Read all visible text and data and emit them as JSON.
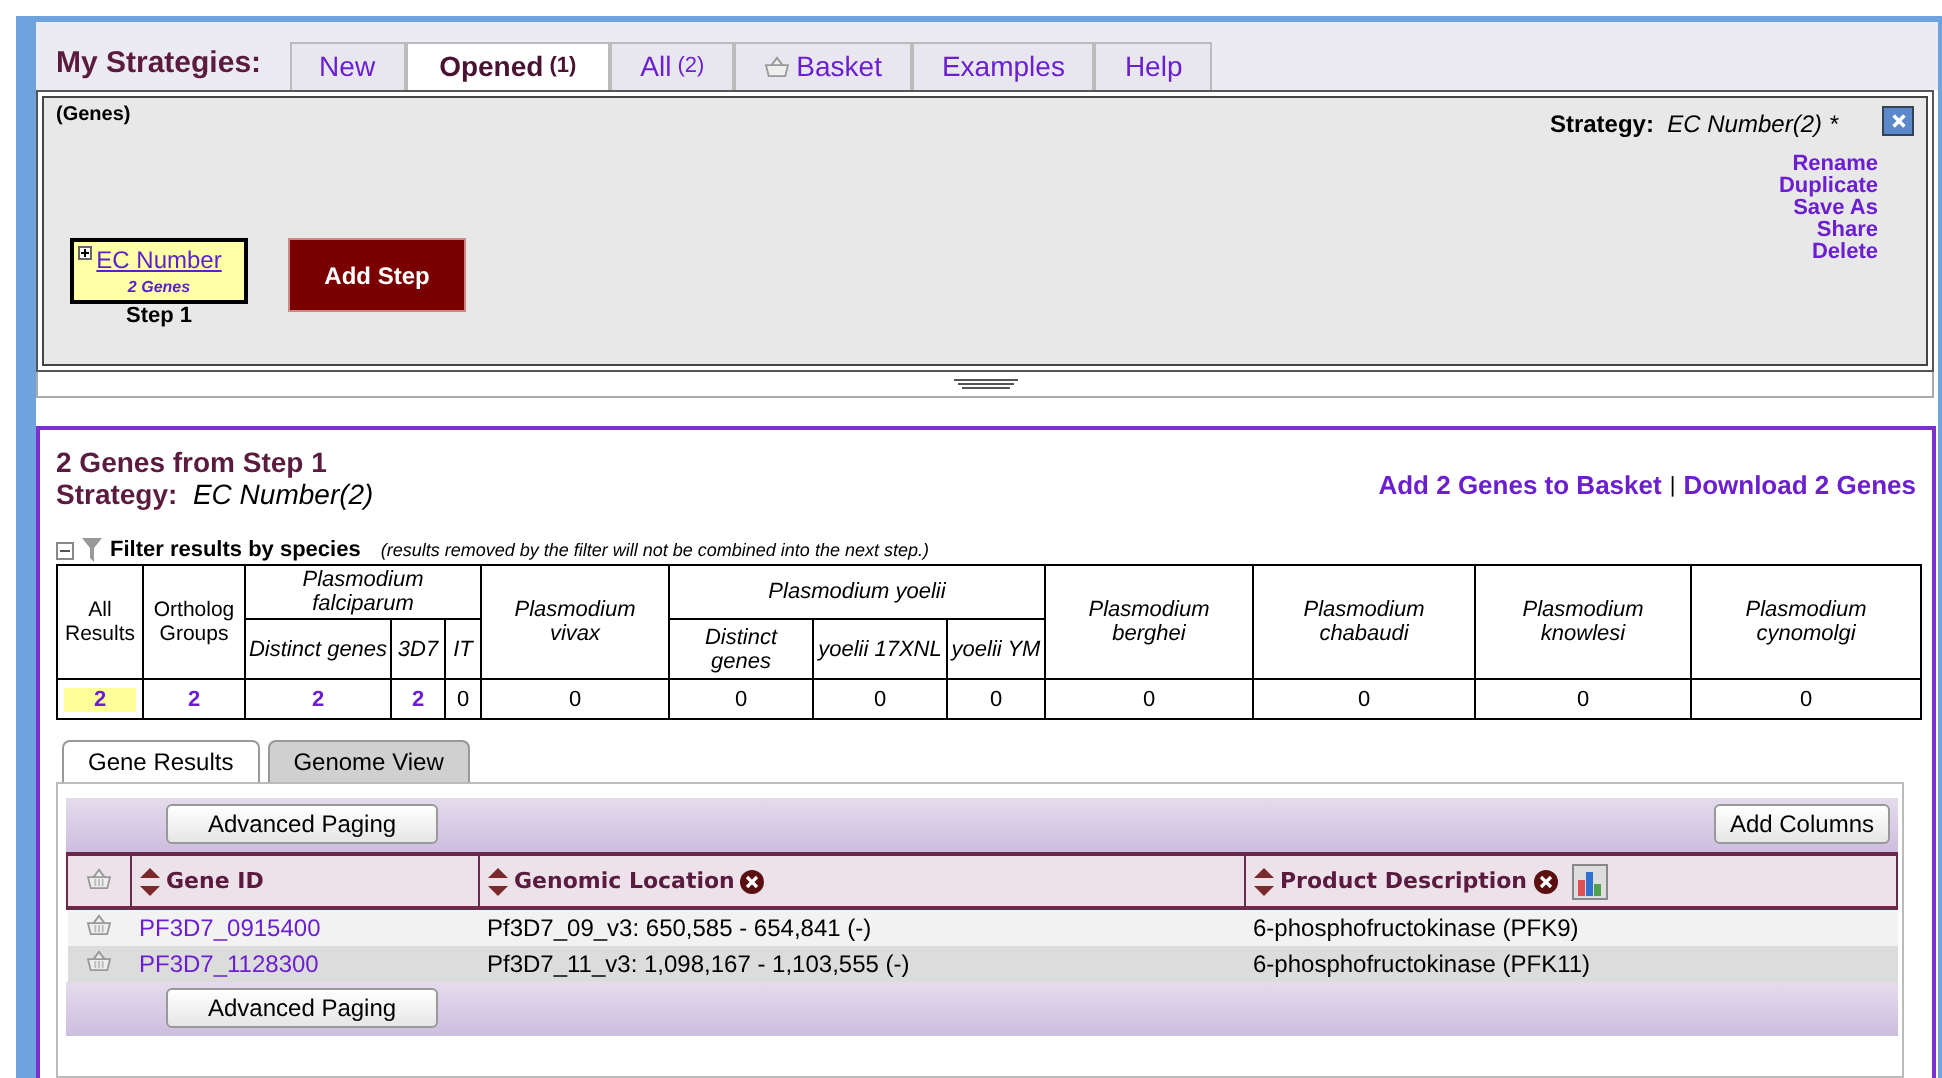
{
  "header": {
    "title": "My Strategies:"
  },
  "tabs": [
    {
      "label": "New",
      "kind": "text",
      "selected": false
    },
    {
      "label": "Opened",
      "count": "(1)",
      "kind": "text",
      "selected": true
    },
    {
      "label": "All",
      "count": "(2)",
      "kind": "text",
      "selected": false
    },
    {
      "label": "Basket",
      "kind": "basket",
      "selected": false
    },
    {
      "label": "Examples",
      "kind": "text",
      "selected": false
    },
    {
      "label": "Help",
      "kind": "text",
      "selected": false
    }
  ],
  "strategy_panel": {
    "type_label": "(Genes)",
    "strategy_label": "Strategy:",
    "strategy_name": "EC Number(2) *",
    "actions": [
      "Rename",
      "Duplicate",
      "Save As",
      "Share",
      "Delete"
    ],
    "step": {
      "name": "EC Number",
      "count": "2 Genes",
      "label": "Step 1"
    },
    "add_step": "Add Step"
  },
  "results": {
    "title": "2 Genes from Step 1",
    "strategy_label": "Strategy:",
    "strategy_name": "EC Number(2)",
    "links": [
      "Add 2 Genes to Basket",
      "Download 2 Genes"
    ],
    "link_separator": "|",
    "filter": {
      "title": "Filter results by species",
      "note": "(results removed by the filter will not be combined into the next step.)",
      "expanded": true,
      "columns": [
        {
          "label": "All Results",
          "kind": "summary"
        },
        {
          "label": "Ortholog Groups",
          "kind": "summary"
        },
        {
          "label": "Plasmodium falciparum",
          "kind": "species",
          "children": [
            "Distinct genes",
            "3D7",
            "IT"
          ]
        },
        {
          "label": "Plasmodium vivax",
          "kind": "species"
        },
        {
          "label": "Plasmodium yoelii",
          "kind": "species",
          "children": [
            "Distinct genes",
            "yoelii 17XNL",
            "yoelii YM"
          ]
        },
        {
          "label": "Plasmodium berghei",
          "kind": "species"
        },
        {
          "label": "Plasmodium chabaudi",
          "kind": "species"
        },
        {
          "label": "Plasmodium knowlesi",
          "kind": "species"
        },
        {
          "label": "Plasmodium cynomolgi",
          "kind": "species"
        }
      ],
      "counts": [
        {
          "value": "2",
          "linked": true,
          "selected": true
        },
        {
          "value": "2",
          "linked": true,
          "selected": false
        },
        {
          "value": "2",
          "linked": true,
          "selected": false
        },
        {
          "value": "2",
          "linked": true,
          "selected": false
        },
        {
          "value": "0",
          "linked": false,
          "selected": false
        },
        {
          "value": "0",
          "linked": false,
          "selected": false
        },
        {
          "value": "0",
          "linked": false,
          "selected": false
        },
        {
          "value": "0",
          "linked": false,
          "selected": false
        },
        {
          "value": "0",
          "linked": false,
          "selected": false
        },
        {
          "value": "0",
          "linked": false,
          "selected": false
        },
        {
          "value": "0",
          "linked": false,
          "selected": false
        },
        {
          "value": "0",
          "linked": false,
          "selected": false
        },
        {
          "value": "0",
          "linked": false,
          "selected": false
        }
      ]
    },
    "view_tabs": [
      {
        "label": "Gene Results",
        "selected": true
      },
      {
        "label": "Genome View",
        "selected": false
      }
    ],
    "paging_button": "Advanced Paging",
    "add_columns": "Add Columns",
    "paging_button_bottom": "Advanced Paging",
    "table": {
      "columns": [
        {
          "label": "Gene ID",
          "removable": false,
          "chart": false
        },
        {
          "label": "Genomic Location",
          "removable": true,
          "chart": false
        },
        {
          "label": "Product Description",
          "removable": true,
          "chart": true
        }
      ],
      "rows": [
        [
          "PF3D7_0915400",
          "Pf3D7_09_v3: 650,585 - 654,841 (-)",
          "6-phosphofructokinase (PFK9)"
        ],
        [
          "PF3D7_1128300",
          "Pf3D7_11_v3: 1,098,167 - 1,103,555 (-)",
          "6-phosphofructokinase (PFK11)"
        ]
      ]
    }
  }
}
